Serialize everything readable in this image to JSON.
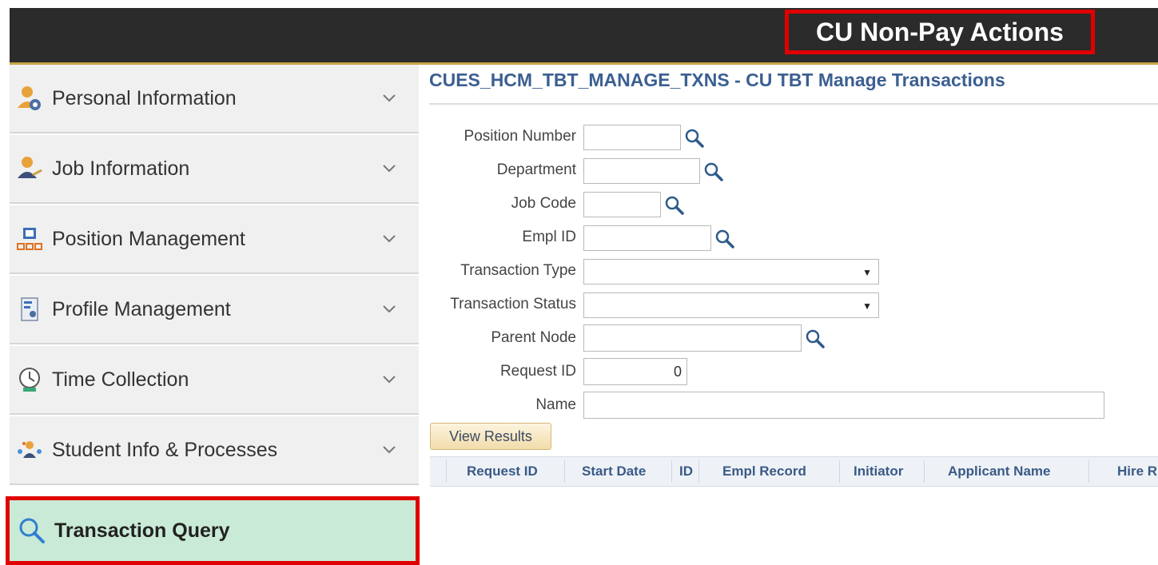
{
  "header": {
    "title": "CU Non-Pay Actions"
  },
  "sidebar": {
    "items": [
      {
        "label": "Personal Information",
        "icon": "person-info-icon"
      },
      {
        "label": "Job Information",
        "icon": "job-info-icon"
      },
      {
        "label": "Position Management",
        "icon": "position-management-icon"
      },
      {
        "label": "Profile Management",
        "icon": "profile-management-icon"
      },
      {
        "label": "Time Collection",
        "icon": "clock-icon"
      },
      {
        "label": "Student Info & Processes",
        "icon": "student-info-icon"
      }
    ],
    "active": {
      "label": "Transaction Query",
      "icon": "search-icon"
    }
  },
  "main": {
    "title": "CUES_HCM_TBT_MANAGE_TXNS - CU TBT Manage Transactions",
    "fields": {
      "position_number": {
        "label": "Position Number",
        "value": ""
      },
      "department": {
        "label": "Department",
        "value": ""
      },
      "job_code": {
        "label": "Job Code",
        "value": ""
      },
      "empl_id": {
        "label": "Empl ID",
        "value": ""
      },
      "transaction_type": {
        "label": "Transaction Type",
        "value": ""
      },
      "transaction_status": {
        "label": "Transaction Status",
        "value": ""
      },
      "parent_node": {
        "label": "Parent Node",
        "value": ""
      },
      "request_id": {
        "label": "Request ID",
        "value": "0"
      },
      "name": {
        "label": "Name",
        "value": ""
      }
    },
    "view_results_label": "View Results",
    "grid_columns": [
      "Request ID",
      "Start Date",
      "ID",
      "Empl Record",
      "Initiator",
      "Applicant Name",
      "Hire R"
    ]
  },
  "colors": {
    "header_bg": "#2b2b2b",
    "highlight_border": "#e00000",
    "active_bg": "#c9ead6",
    "title_blue": "#3b5f91"
  }
}
